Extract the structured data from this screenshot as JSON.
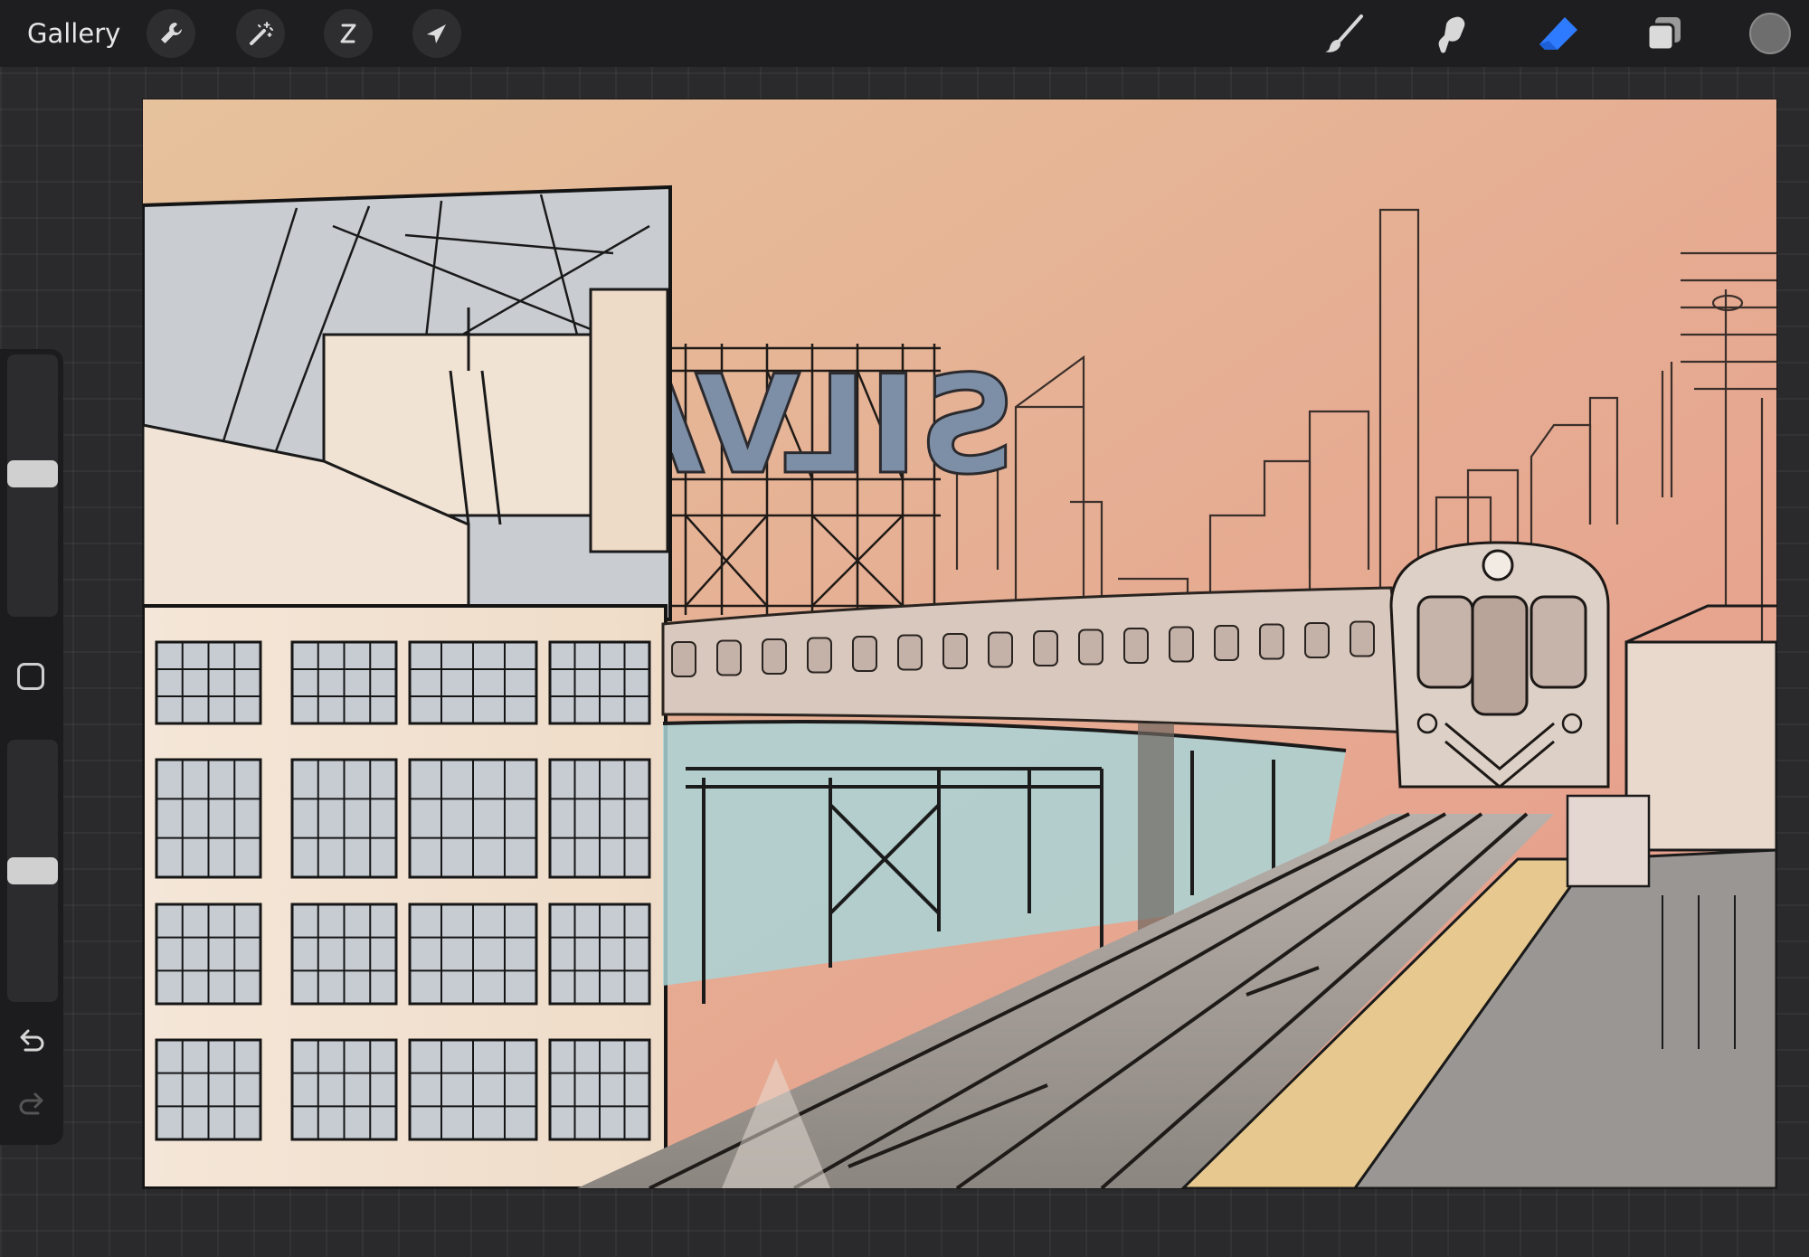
{
  "toolbar": {
    "gallery_label": "Gallery",
    "left_tools": [
      {
        "name": "actions",
        "icon": "wrench-icon"
      },
      {
        "name": "adjustments",
        "icon": "magic-wand-icon"
      },
      {
        "name": "selection",
        "icon": "selection-s-icon"
      },
      {
        "name": "transform",
        "icon": "arrow-cursor-icon"
      }
    ],
    "right_tools": [
      {
        "name": "brush",
        "icon": "brush-icon",
        "active": false
      },
      {
        "name": "smudge",
        "icon": "smudge-finger-icon",
        "active": false
      },
      {
        "name": "eraser",
        "icon": "eraser-icon",
        "active": true
      },
      {
        "name": "layers",
        "icon": "layers-icon",
        "active": false
      }
    ],
    "accent_color": "#2f7bff",
    "current_color": "#6e6e6e"
  },
  "sidebar": {
    "brush_size_level": 0.55,
    "opacity_level": 0.5,
    "modify_icon": "square-modify-icon",
    "undo_icon": "undo-icon",
    "redo_icon": "redo-icon"
  },
  "canvas": {
    "sign_text": "SILVA",
    "sky_top_color": "#e6c29c",
    "sky_bottom_color": "#e7998a"
  }
}
